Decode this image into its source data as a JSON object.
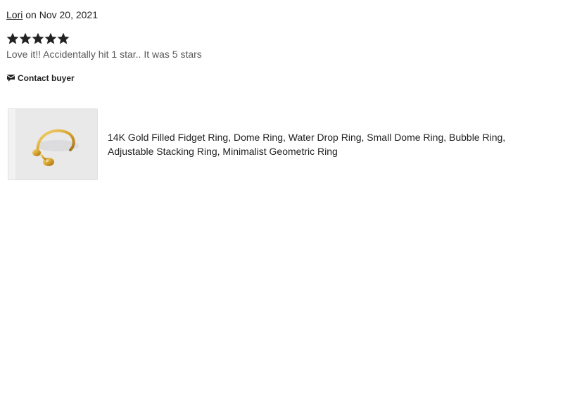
{
  "review": {
    "reviewer_name": "Lori",
    "date_text": " on Nov 20, 2021",
    "rating": 5,
    "rating_max": 5,
    "text": "Love it!! Accidentally hit 1 star.. It was 5 stars",
    "star_color": "#222222"
  },
  "contact": {
    "icon": "envelope-icon",
    "label": "Contact buyer"
  },
  "listing": {
    "title": "14K Gold Filled Fidget Ring, Dome Ring, Water Drop Ring, Small Dome Ring, Bubble Ring, Adjustable Stacking Ring, Minimalist Geometric Ring",
    "image": "gold-ring-product-image"
  }
}
